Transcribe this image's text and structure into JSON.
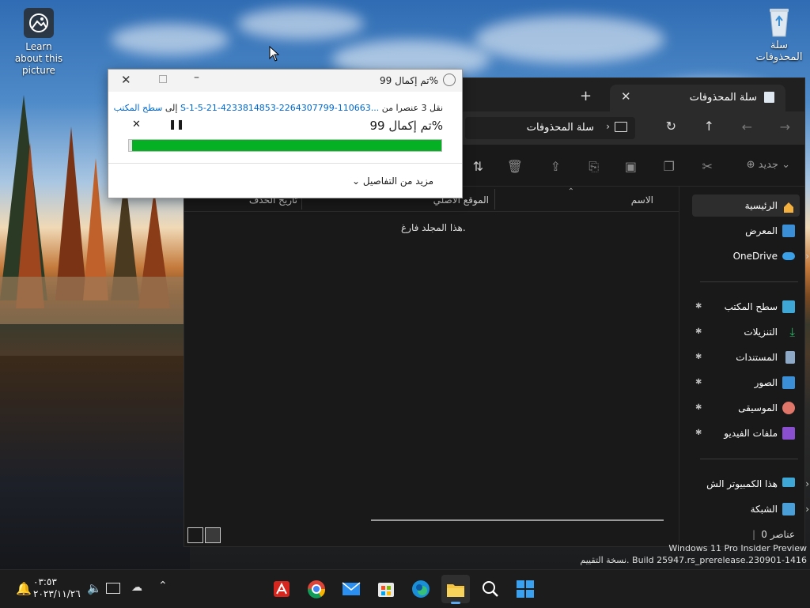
{
  "desktop": {
    "learn_icon_label": "Learn about this picture",
    "recycle_icon_label": "سلة المحذوفات",
    "watermark_line1": "Windows 11 Pro Insider Preview",
    "watermark_line2": "نسخة التقييم. Build 25947.rs_prerelease.230901-1416"
  },
  "explorer": {
    "tab_title": "سلة المحذوفات",
    "address_text": "سلة المحذوفات",
    "new_label": "جديد",
    "columns": {
      "name": "الاسم",
      "original_location": "الموقع الأصلي",
      "date_deleted": "تاريخ الحذف"
    },
    "empty_message": "هذا المجلد فارغ.",
    "status_count": "0 عناصر",
    "nav": {
      "home": "الرئيسية",
      "gallery": "المعرض",
      "onedrive": "OneDrive",
      "desktop": "سطح المكتب",
      "downloads": "التنزيلات",
      "documents": "المستندات",
      "pictures": "الصور",
      "music": "الموسيقى",
      "videos": "ملفات الفيديو",
      "this_pc": "هذا الكمبيوتر الش",
      "network": "الشبكة"
    }
  },
  "dialog": {
    "title": "تم إكمال 99%",
    "line_prefix": "نقل 3 عنصرا من",
    "source": "...S-1-5-21-4233814853-2264307799-110663",
    "to_word": "إلى",
    "destination": "سطح المكتب",
    "progress_label": "تم إكمال 99%",
    "progress": 0.99,
    "more_details": "مزيد من التفاصيل"
  },
  "taskbar": {
    "time": "٠٣:٥٣",
    "date": "٢٠٢٣/١١/٢٦"
  },
  "colors": {
    "progress_green": "#06b025",
    "link_blue": "#0066cc",
    "explorer_bg": "#191919"
  }
}
